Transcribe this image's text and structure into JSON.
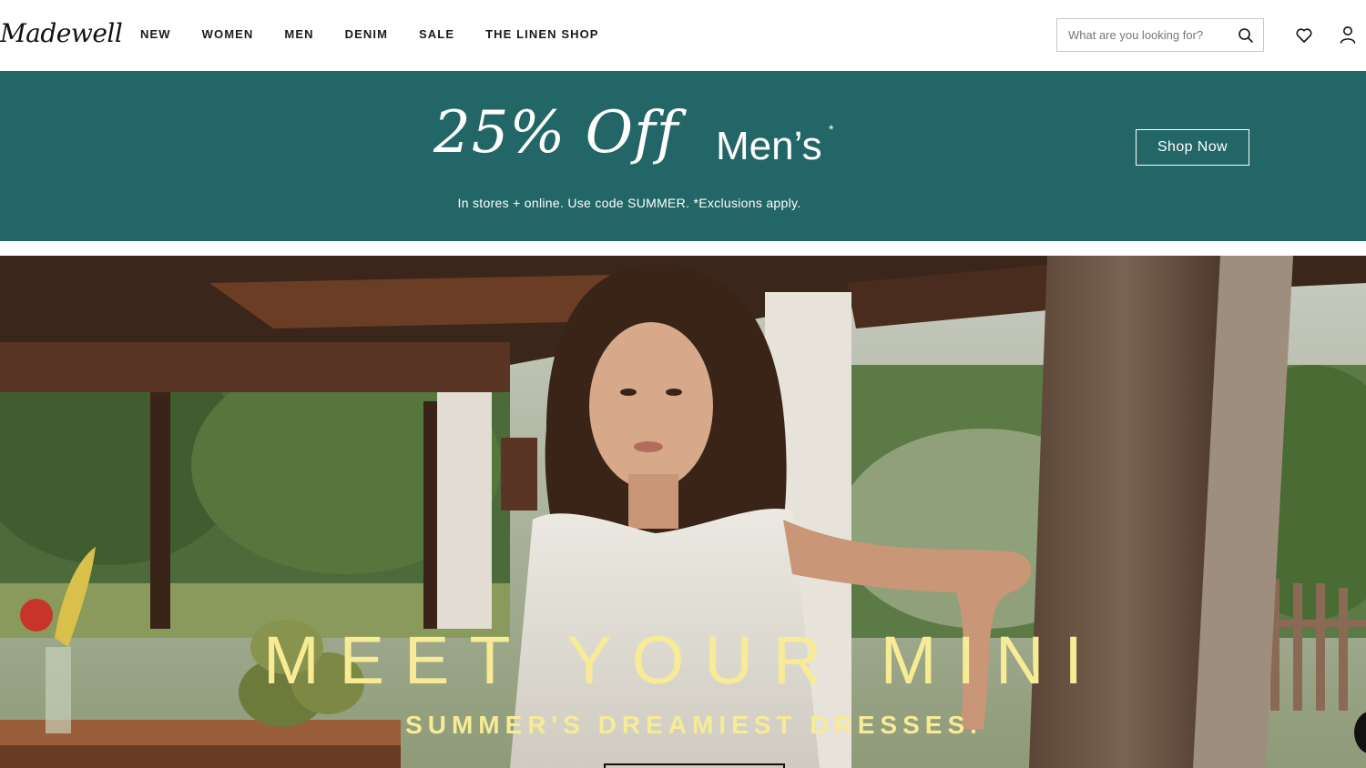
{
  "header": {
    "logo_text": "Madewell",
    "nav": [
      "NEW",
      "WOMEN",
      "MEN",
      "DENIM",
      "SALE",
      "THE LINEN SHOP"
    ],
    "search_placeholder": "What are you looking for?",
    "icons": [
      "search-icon",
      "heart-icon",
      "user-icon"
    ]
  },
  "promo": {
    "headline": "25% Off",
    "category": "Men’s",
    "asterisk": "*",
    "subtext": "In stores + online. Use code SUMMER. *Exclusions apply.",
    "cta_label": "Shop Now",
    "background_color": "#236667"
  },
  "hero": {
    "title": "MEET YOUR MINI",
    "subtitle": "SUMMER'S DREAMIEST DRESSES.",
    "text_color": "#f7ec95"
  }
}
